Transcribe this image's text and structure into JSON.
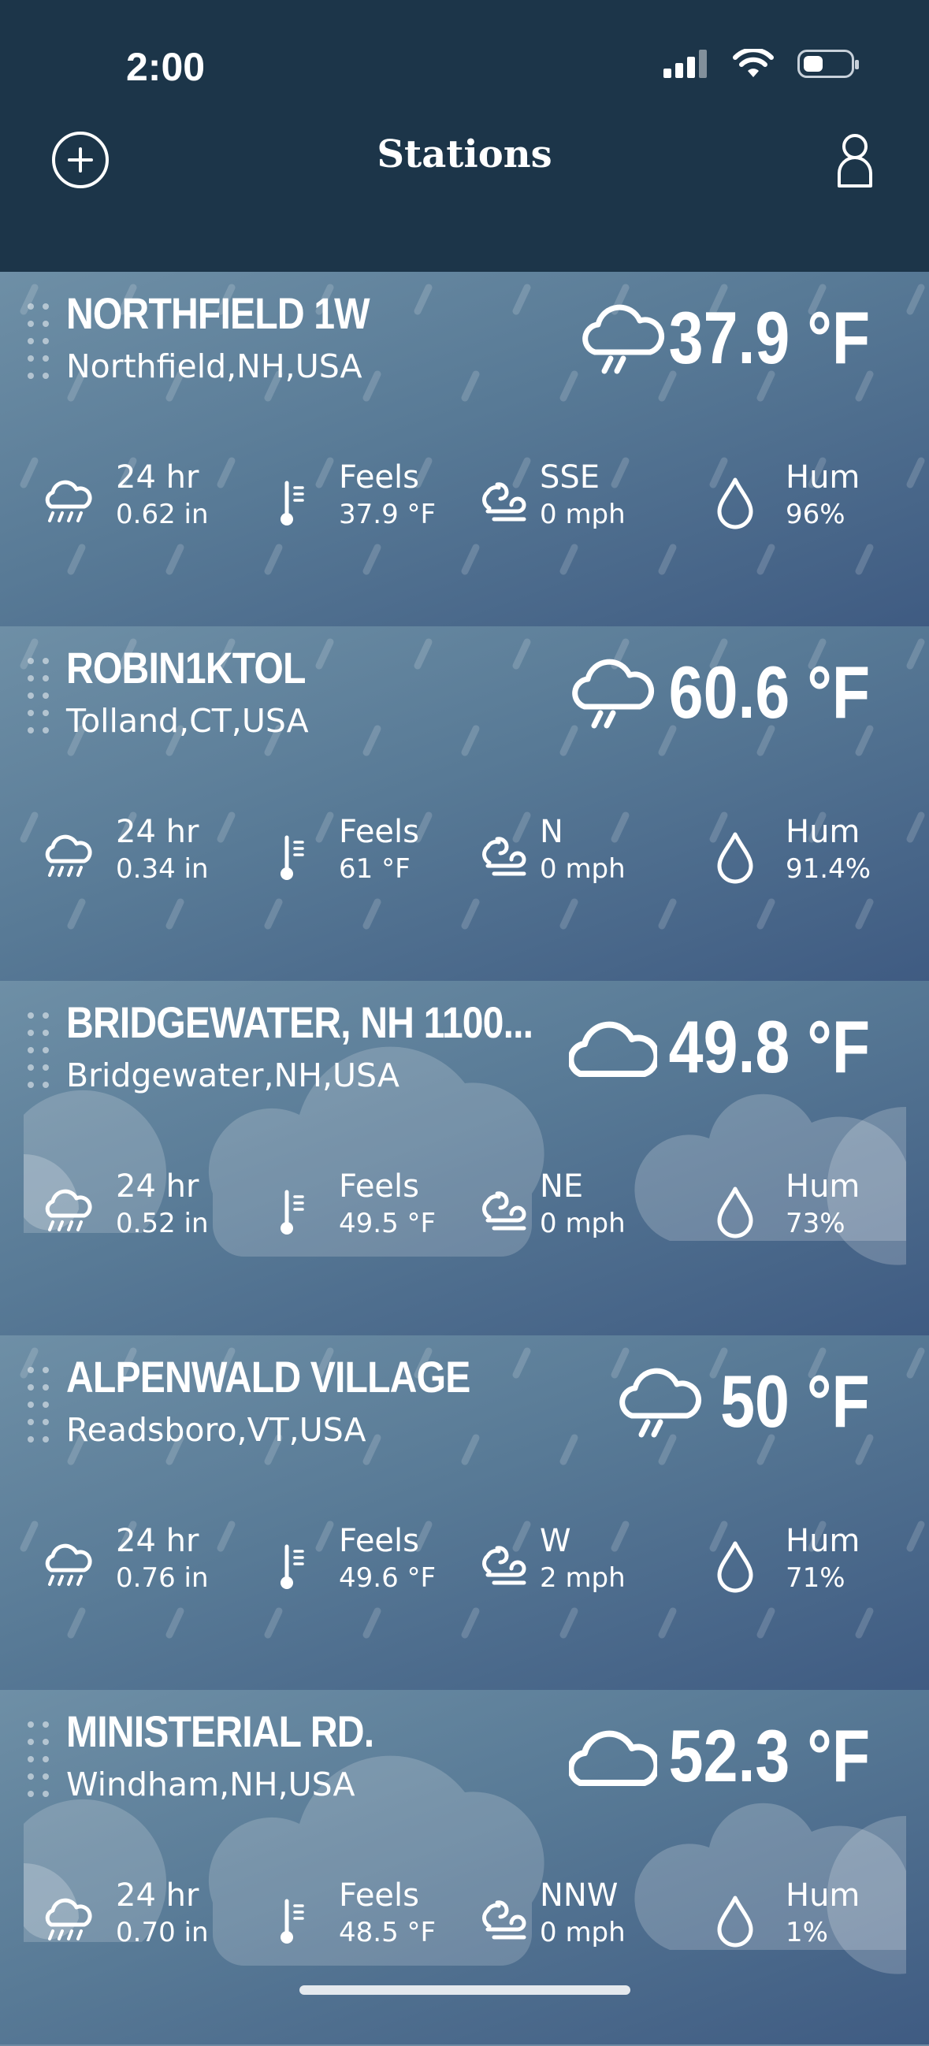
{
  "status_bar": {
    "time": "2:00"
  },
  "nav": {
    "title": "Stations"
  },
  "units": {
    "temp": "°F"
  },
  "stations": [
    {
      "name": "NORTHFIELD 1W",
      "location": "Northfield,NH,USA",
      "condition": "rain",
      "temperature": "37.9 °F",
      "rain_label": "24 hr",
      "rain_value": "0.62 in",
      "feels_label": "Feels",
      "feels_value": "37.9 °F",
      "wind_dir": "SSE",
      "wind_speed": "0 mph",
      "hum_label": "Hum",
      "hum_value": "96%"
    },
    {
      "name": "ROBIN1KTOL",
      "location": "Tolland,CT,USA",
      "condition": "rain",
      "temperature": "60.6 °F",
      "rain_label": "24 hr",
      "rain_value": "0.34 in",
      "feels_label": "Feels",
      "feels_value": "61 °F",
      "wind_dir": "N",
      "wind_speed": "0 mph",
      "hum_label": "Hum",
      "hum_value": "91.4%"
    },
    {
      "name": "BRIDGEWATER, NH  1100...",
      "location": "Bridgewater,NH,USA",
      "condition": "cloudy",
      "temperature": "49.8 °F",
      "rain_label": "24 hr",
      "rain_value": "0.52 in",
      "feels_label": "Feels",
      "feels_value": "49.5 °F",
      "wind_dir": "NE",
      "wind_speed": "0 mph",
      "hum_label": "Hum",
      "hum_value": "73%"
    },
    {
      "name": "ALPENWALD VILLAGE",
      "location": "Readsboro,VT,USA",
      "condition": "rain",
      "temperature": "50 °F",
      "rain_label": "24 hr",
      "rain_value": "0.76 in",
      "feels_label": "Feels",
      "feels_value": "49.6 °F",
      "wind_dir": "W",
      "wind_speed": "2 mph",
      "hum_label": "Hum",
      "hum_value": "71%"
    },
    {
      "name": "MINISTERIAL RD.",
      "location": "Windham,NH,USA",
      "condition": "cloudy",
      "temperature": "52.3 °F",
      "rain_label": "24 hr",
      "rain_value": "0.70 in",
      "feels_label": "Feels",
      "feels_value": "48.5 °F",
      "wind_dir": "NNW",
      "wind_speed": "0 mph",
      "hum_label": "Hum",
      "hum_value": "1%"
    }
  ],
  "icons": {
    "add": "plus-circle-icon",
    "user": "user-icon",
    "rain": "cloud-rain-icon",
    "cloudy": "cloud-icon",
    "rain_gauge": "rain-gauge-icon",
    "thermometer": "thermometer-icon",
    "wind": "wind-icon",
    "humidity": "droplet-icon"
  },
  "colors": {
    "header": "#1c3549",
    "card_top": "#6e8fa6",
    "card_bottom": "#3f5b82",
    "text": "#ffffff"
  }
}
